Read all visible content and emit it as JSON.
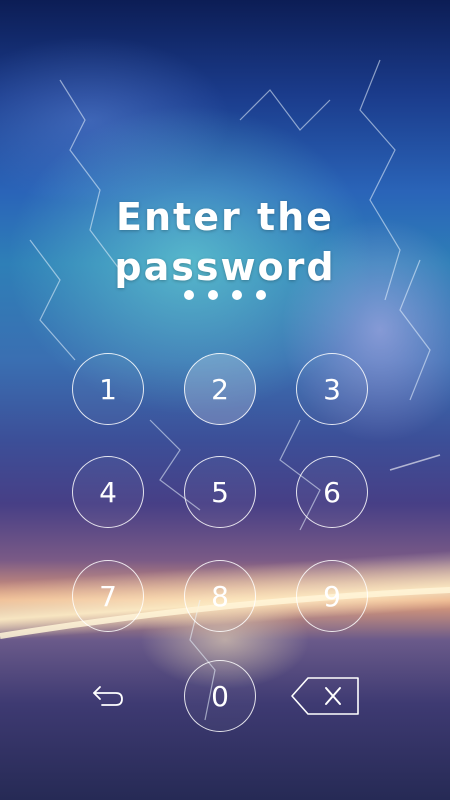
{
  "lock_screen": {
    "title": "Enter the password",
    "entered_digits_count": 4
  },
  "keypad": {
    "keys": [
      "1",
      "2",
      "3",
      "4",
      "5",
      "6",
      "7",
      "8",
      "9",
      "0"
    ],
    "highlighted_key": "2",
    "back_icon": "back-arrow-icon",
    "delete_icon": "backspace-icon"
  }
}
